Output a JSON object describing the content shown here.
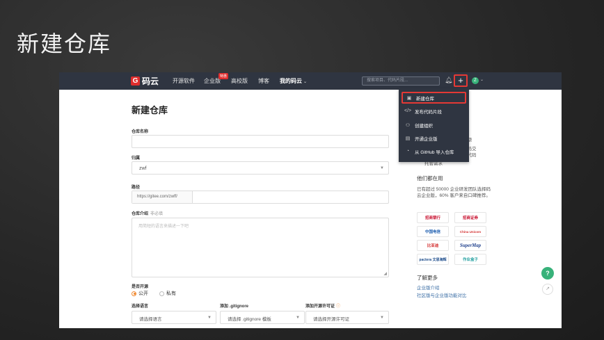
{
  "slide": {
    "title": "新建仓库"
  },
  "nav": {
    "logo_text": "码云",
    "items": [
      "开源软件",
      "企业版",
      "高校版",
      "博客",
      "我的码云"
    ],
    "enterprise_badge": "特惠",
    "mine_caret": "⌄",
    "search_placeholder": "搜索项目、代码片段...",
    "plus": "+",
    "avatar_letter": "Z"
  },
  "dropdown": {
    "items": [
      {
        "icon": "▣",
        "label": "新建仓库"
      },
      {
        "icon": "</>",
        "label": "发布代码片段"
      },
      {
        "icon": "⚇",
        "label": "创建组织"
      },
      {
        "icon": "▤",
        "label": "开通企业版"
      },
      {
        "icon": "◔",
        "label": "从 GitHub 导入仓库"
      }
    ]
  },
  "form": {
    "title": "新建仓库",
    "repo_name_label": "仓库名称",
    "owner_label": "归属",
    "owner_value": "zwf",
    "path_label": "路径",
    "path_prefix": "https://gitee.com/zwff/",
    "desc_label": "仓库介绍",
    "desc_optional": "非必填",
    "desc_placeholder": "用简短的语言来描述一下吧",
    "visibility_label": "是否开源",
    "public_label": "公开",
    "private_label": "私有",
    "language_label": "选择语言",
    "language_value": "请选择语言",
    "gitignore_label": "添加 .gitignore",
    "gitignore_value": "请选择 .gitignore 模板",
    "license_label": "添加开源许可证",
    "license_value": "请选择开源许可证"
  },
  "side": {
    "partial1": "配额",
    "partial2": "代码交",
    "partial3": "是代码",
    "partial4": "托管需求",
    "using_title": "他们都在用",
    "using_desc": "已有超过 50000 企业研发团队选择码云企业版，60% 客户来自口碑推荐。",
    "logos": [
      "招商银行",
      "招商证券",
      "中国电信",
      "China Unicom",
      "比亚迪",
      "SuperMap",
      "pactera 文思海辉",
      "作业盒子"
    ],
    "more_title": "了解更多",
    "links": [
      "企业版介绍",
      "社区版与企业版功能对比"
    ]
  },
  "float": {
    "help": "?",
    "external": "↗"
  }
}
